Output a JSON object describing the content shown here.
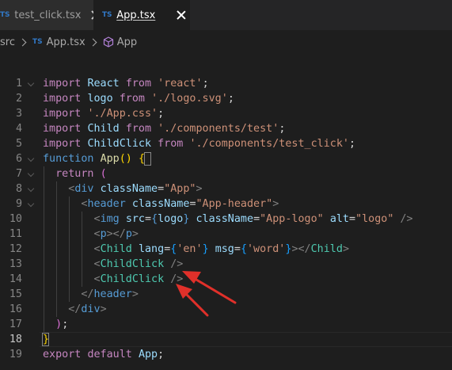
{
  "tabs": [
    {
      "badge": "TS",
      "label": "test_click.tsx",
      "active": false
    },
    {
      "badge": "TS",
      "label": "App.tsx",
      "active": true
    }
  ],
  "breadcrumb": {
    "folder": "src",
    "file_badge": "TS",
    "file": "App.tsx",
    "symbol": "App"
  },
  "editor": {
    "current_line": 18,
    "lines": [
      {
        "n": "1",
        "tokens": [
          [
            "kw",
            "import"
          ],
          [
            "pl",
            " "
          ],
          [
            "id",
            "React"
          ],
          [
            "pl",
            " "
          ],
          [
            "kw",
            "from"
          ],
          [
            "pl",
            " "
          ],
          [
            "str",
            "'react'"
          ],
          [
            "pl",
            ";"
          ]
        ]
      },
      {
        "n": "2",
        "tokens": [
          [
            "kw",
            "import"
          ],
          [
            "pl",
            " "
          ],
          [
            "id",
            "logo"
          ],
          [
            "pl",
            " "
          ],
          [
            "kw",
            "from"
          ],
          [
            "pl",
            " "
          ],
          [
            "str",
            "'./logo.svg'"
          ],
          [
            "pl",
            ";"
          ]
        ]
      },
      {
        "n": "3",
        "tokens": [
          [
            "kw",
            "import"
          ],
          [
            "pl",
            " "
          ],
          [
            "str",
            "'./App.css'"
          ],
          [
            "pl",
            ";"
          ]
        ]
      },
      {
        "n": "4",
        "tokens": [
          [
            "kw",
            "import"
          ],
          [
            "pl",
            " "
          ],
          [
            "id",
            "Child"
          ],
          [
            "pl",
            " "
          ],
          [
            "kw",
            "from"
          ],
          [
            "pl",
            " "
          ],
          [
            "str",
            "'./components/test'"
          ],
          [
            "pl",
            ";"
          ]
        ]
      },
      {
        "n": "5",
        "tokens": [
          [
            "kw",
            "import"
          ],
          [
            "pl",
            " "
          ],
          [
            "id",
            "ChildClick"
          ],
          [
            "pl",
            " "
          ],
          [
            "kw",
            "from"
          ],
          [
            "pl",
            " "
          ],
          [
            "str",
            "'./components/test_click'"
          ],
          [
            "pl",
            ";"
          ]
        ]
      },
      {
        "n": "6",
        "tokens": [
          [
            "kwb",
            "function"
          ],
          [
            "pl",
            " "
          ],
          [
            "fn",
            "App"
          ],
          [
            "brk1",
            "()"
          ],
          [
            "pl",
            " "
          ],
          [
            "brk1",
            "{"
          ]
        ]
      },
      {
        "n": "7",
        "tokens": [
          [
            "pl",
            "  "
          ],
          [
            "kw",
            "return"
          ],
          [
            "pl",
            " "
          ],
          [
            "brk2",
            "("
          ]
        ]
      },
      {
        "n": "8",
        "tokens": [
          [
            "pl",
            "    "
          ],
          [
            "punc",
            "<"
          ],
          [
            "tag",
            "div"
          ],
          [
            "pl",
            " "
          ],
          [
            "attr",
            "className"
          ],
          [
            "pl",
            "="
          ],
          [
            "str",
            "\"App\""
          ],
          [
            "punc",
            ">"
          ]
        ]
      },
      {
        "n": "9",
        "tokens": [
          [
            "pl",
            "      "
          ],
          [
            "punc",
            "<"
          ],
          [
            "tag",
            "header"
          ],
          [
            "pl",
            " "
          ],
          [
            "attr",
            "className"
          ],
          [
            "pl",
            "="
          ],
          [
            "str",
            "\"App-header\""
          ],
          [
            "punc",
            ">"
          ]
        ]
      },
      {
        "n": "10",
        "tokens": [
          [
            "pl",
            "        "
          ],
          [
            "punc",
            "<"
          ],
          [
            "tag",
            "img"
          ],
          [
            "pl",
            " "
          ],
          [
            "attr",
            "src"
          ],
          [
            "pl",
            "="
          ],
          [
            "kwb",
            "{"
          ],
          [
            "id",
            "logo"
          ],
          [
            "kwb",
            "}"
          ],
          [
            "pl",
            " "
          ],
          [
            "attr",
            "className"
          ],
          [
            "pl",
            "="
          ],
          [
            "str",
            "\"App-logo\""
          ],
          [
            "pl",
            " "
          ],
          [
            "attr",
            "alt"
          ],
          [
            "pl",
            "="
          ],
          [
            "str",
            "\"logo\""
          ],
          [
            "pl",
            " "
          ],
          [
            "punc",
            "/>"
          ]
        ]
      },
      {
        "n": "11",
        "tokens": [
          [
            "pl",
            "        "
          ],
          [
            "punc",
            "<"
          ],
          [
            "tag",
            "p"
          ],
          [
            "punc",
            "></"
          ],
          [
            "tag",
            "p"
          ],
          [
            "punc",
            ">"
          ]
        ]
      },
      {
        "n": "12",
        "tokens": [
          [
            "pl",
            "        "
          ],
          [
            "punc",
            "<"
          ],
          [
            "comp",
            "Child"
          ],
          [
            "pl",
            " "
          ],
          [
            "attr",
            "lang"
          ],
          [
            "pl",
            "="
          ],
          [
            "brk3",
            "{"
          ],
          [
            "str",
            "'en'"
          ],
          [
            "brk3",
            "}"
          ],
          [
            "pl",
            " "
          ],
          [
            "attr",
            "msg"
          ],
          [
            "pl",
            "="
          ],
          [
            "brk3",
            "{"
          ],
          [
            "str",
            "'word'"
          ],
          [
            "brk3",
            "}"
          ],
          [
            "punc",
            "></"
          ],
          [
            "comp",
            "Child"
          ],
          [
            "punc",
            ">"
          ]
        ]
      },
      {
        "n": "13",
        "tokens": [
          [
            "pl",
            "        "
          ],
          [
            "punc",
            "<"
          ],
          [
            "comp",
            "ChildClick"
          ],
          [
            "pl",
            " "
          ],
          [
            "punc",
            "/>"
          ]
        ]
      },
      {
        "n": "14",
        "tokens": [
          [
            "pl",
            "        "
          ],
          [
            "punc",
            "<"
          ],
          [
            "comp",
            "ChildClick"
          ],
          [
            "pl",
            " "
          ],
          [
            "punc",
            "/>"
          ]
        ]
      },
      {
        "n": "15",
        "tokens": [
          [
            "pl",
            "      "
          ],
          [
            "punc",
            "</"
          ],
          [
            "tag",
            "header"
          ],
          [
            "punc",
            ">"
          ]
        ]
      },
      {
        "n": "16",
        "tokens": [
          [
            "pl",
            "    "
          ],
          [
            "punc",
            "</"
          ],
          [
            "tag",
            "div"
          ],
          [
            "punc",
            ">"
          ]
        ]
      },
      {
        "n": "17",
        "tokens": [
          [
            "pl",
            "  "
          ],
          [
            "brk2",
            ")"
          ],
          [
            "pl",
            ";"
          ]
        ]
      },
      {
        "n": "18",
        "tokens": [
          [
            "brk1",
            "}"
          ]
        ]
      },
      {
        "n": "19",
        "tokens": [
          [
            "kw",
            "export"
          ],
          [
            "pl",
            " "
          ],
          [
            "kw",
            "default"
          ],
          [
            "pl",
            " "
          ],
          [
            "id",
            "App"
          ],
          [
            "pl",
            ";"
          ]
        ]
      }
    ],
    "folds": [
      1,
      6,
      7,
      8,
      9
    ]
  },
  "colors": {
    "annotation_arrow": "#e0302a",
    "ts_badge": "#3178c6",
    "symbol_icon": "#b180d7"
  }
}
